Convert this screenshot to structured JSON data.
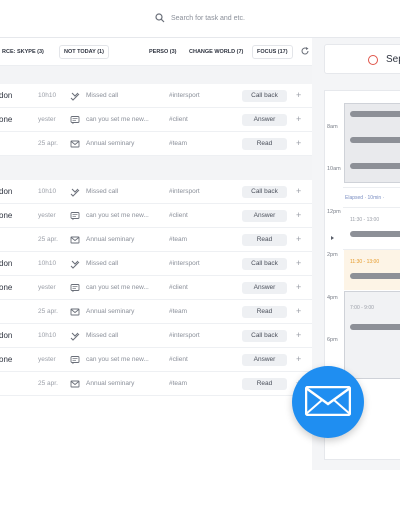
{
  "search": {
    "placeholder": "Search for task and etc."
  },
  "filters": [
    {
      "label": "RCE: SKYPE (3)"
    },
    {
      "label": "NOT TODAY (1)"
    },
    {
      "label": "PERSO (3)"
    },
    {
      "label": "CHANGE WORLD (7)"
    },
    {
      "label": "FOCUS (17)"
    }
  ],
  "groups": [
    {
      "rows": [
        {
          "name": "don",
          "time": "10h10",
          "icon": "missed-call-icon",
          "subject": "Missed call",
          "tag": "#intersport",
          "action": "Call back"
        },
        {
          "name": "one",
          "time": "yester",
          "icon": "message-icon",
          "subject": "can you set me new...",
          "tag": "#client",
          "action": "Answer"
        },
        {
          "name": "",
          "time": "25 apr.",
          "icon": "mail-icon",
          "subject": "Annual seminary",
          "tag": "#team",
          "action": "Read"
        }
      ]
    },
    {
      "rows": [
        {
          "name": "don",
          "time": "10h10",
          "icon": "missed-call-icon",
          "subject": "Missed call",
          "tag": "#intersport",
          "action": "Call back"
        },
        {
          "name": "one",
          "time": "yester",
          "icon": "message-icon",
          "subject": "can you set me new...",
          "tag": "#client",
          "action": "Answer"
        },
        {
          "name": "",
          "time": "25 apr.",
          "icon": "mail-icon",
          "subject": "Annual seminary",
          "tag": "#team",
          "action": "Read"
        },
        {
          "name": "don",
          "time": "10h10",
          "icon": "missed-call-icon",
          "subject": "Missed call",
          "tag": "#intersport",
          "action": "Call back"
        },
        {
          "name": "one",
          "time": "yester",
          "icon": "message-icon",
          "subject": "can you set me new...",
          "tag": "#client",
          "action": "Answer"
        },
        {
          "name": "",
          "time": "25 apr.",
          "icon": "mail-icon",
          "subject": "Annual seminary",
          "tag": "#team",
          "action": "Read"
        },
        {
          "name": "don",
          "time": "10h10",
          "icon": "missed-call-icon",
          "subject": "Missed call",
          "tag": "#intersport",
          "action": "Call back"
        },
        {
          "name": "one",
          "time": "yester",
          "icon": "message-icon",
          "subject": "can you set me new...",
          "tag": "#client",
          "action": "Answer"
        },
        {
          "name": "",
          "time": "25 apr.",
          "icon": "mail-icon",
          "subject": "Annual seminary",
          "tag": "#team",
          "action": "Read"
        }
      ]
    }
  ],
  "row_plus": "+",
  "calendar": {
    "date_label": "Sep",
    "hours": [
      "8am",
      "10am",
      "12pm",
      "2pm",
      "4pm",
      "6pm"
    ],
    "elapsed": "Elapsed · 10min ·",
    "slots": [
      {
        "label": "11:30 - 13:00",
        "highlight": false
      },
      {
        "label": "11:30 - 13:00",
        "highlight": true
      },
      {
        "label": "7:00 - 9:00",
        "highlight": false
      }
    ]
  },
  "colors": {
    "accent": "#1f8ef1",
    "date_circle": "#e0554a",
    "slot_highlight": "#e59a2a"
  }
}
